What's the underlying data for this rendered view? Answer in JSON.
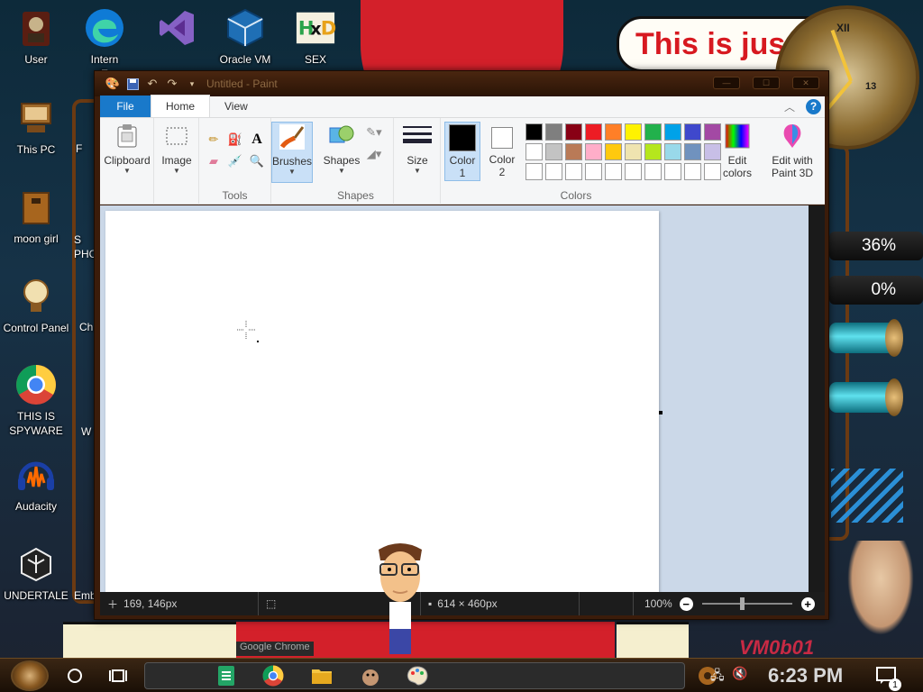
{
  "desktop": {
    "icons": [
      {
        "label": "User"
      },
      {
        "label": "This PC"
      },
      {
        "label": "moon girl"
      },
      {
        "label": "Control Panel"
      },
      {
        "label": "THIS IS SPYWARE"
      },
      {
        "label": "Audacity"
      },
      {
        "label": "UNDERTALE"
      }
    ],
    "top_icons": [
      {
        "label": "Intern\nE"
      },
      {
        "label": ""
      },
      {
        "label": "Oracle VM"
      },
      {
        "label": "SEX"
      }
    ],
    "partial_labels": {
      "f": "F",
      "s_phc": "S\nPHC",
      "ch": "Ch",
      "w": "W",
      "emb": "Emb"
    }
  },
  "wallpaper": {
    "banner_text": "This is jus",
    "meter1": "36%",
    "meter2": "0%",
    "logo": "VM0b01",
    "google_tab": "Google Chrome",
    "clock_numbers": {
      "xii": "XII",
      "num13": "13"
    }
  },
  "paint": {
    "title": "Untitled - Paint",
    "tabs": {
      "file": "File",
      "home": "Home",
      "view": "View"
    },
    "groups": {
      "clipboard": "Clipboard",
      "image": "Image",
      "tools": "Tools",
      "brushes": "Brushes",
      "shapes_btn": "Shapes",
      "shapes_group": "Shapes",
      "size": "Size",
      "color1": "Color\n1",
      "color2": "Color\n2",
      "colors": "Colors",
      "edit_colors": "Edit\ncolors",
      "edit_paint3d": "Edit with\nPaint 3D"
    },
    "palette_row1": [
      "#000000",
      "#7f7f7f",
      "#880015",
      "#ed1c24",
      "#ff7f27",
      "#fff200",
      "#22b14c",
      "#00a2e8",
      "#3f48cc",
      "#a349a4"
    ],
    "palette_row2": [
      "#ffffff",
      "#c3c3c3",
      "#b97a57",
      "#ffaec9",
      "#ffc90e",
      "#efe4b0",
      "#b5e61d",
      "#99d9ea",
      "#7092be",
      "#c8bfe7"
    ],
    "palette_row3": [
      "#ffffff",
      "#ffffff",
      "#ffffff",
      "#ffffff",
      "#ffffff",
      "#ffffff",
      "#ffffff",
      "#ffffff",
      "#ffffff",
      "#ffffff"
    ],
    "color1": "#000000",
    "color2": "#ffffff",
    "status": {
      "cursor_pos": "169, 146px",
      "canvas_size": "614 × 460px",
      "zoom": "100%"
    }
  },
  "taskbar": {
    "time": "6:23 PM",
    "notif_count": "1"
  }
}
